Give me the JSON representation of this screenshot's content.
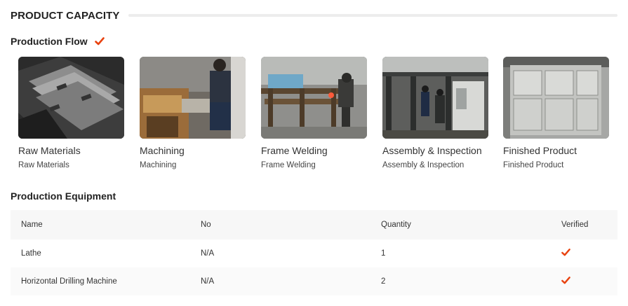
{
  "header": {
    "title": "PRODUCT CAPACITY"
  },
  "flow": {
    "title": "Production Flow",
    "verified_icon": "check-icon",
    "accent_color": "#e8420f",
    "steps": [
      {
        "label": "Raw Materials",
        "caption": "Raw Materials"
      },
      {
        "label": "Machining",
        "caption": "Machining"
      },
      {
        "label": "Frame Welding",
        "caption": "Frame Welding"
      },
      {
        "label": "Assembly & Inspection",
        "caption": "Assembly & Inspection"
      },
      {
        "label": "Finished Product",
        "caption": "Finished Product"
      }
    ]
  },
  "equipment": {
    "title": "Production Equipment",
    "columns": [
      "Name",
      "No",
      "Quantity",
      "Verified"
    ],
    "rows": [
      {
        "name": "Lathe",
        "no": "N/A",
        "quantity": "1",
        "verified": true
      },
      {
        "name": "Horizontal Drilling Machine",
        "no": "N/A",
        "quantity": "2",
        "verified": true
      }
    ]
  }
}
